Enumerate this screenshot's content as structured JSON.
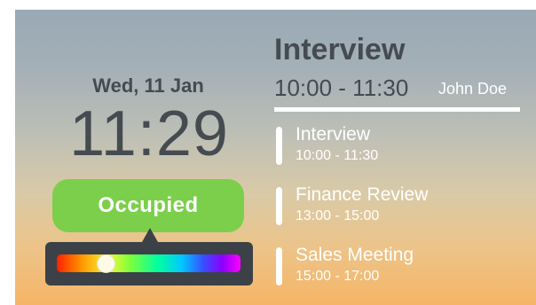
{
  "clock_panel": {
    "date": "Wed, 11 Jan",
    "time": "11:29",
    "status": "Occupied",
    "status_color": "#7ccf4a",
    "color_picker_value": 0.24
  },
  "current_meeting": {
    "title": "Interview",
    "time": "10:00 - 11:30",
    "organizer": "John Doe"
  },
  "agenda": [
    {
      "name": "Interview",
      "time": "10:00 - 11:30"
    },
    {
      "name": "Finance Review",
      "time": "13:00 - 15:00"
    },
    {
      "name": "Sales Meeting",
      "time": "15:00 - 17:00"
    }
  ]
}
